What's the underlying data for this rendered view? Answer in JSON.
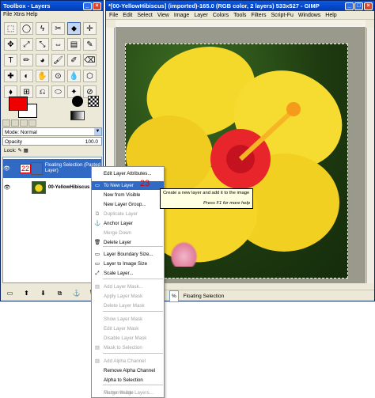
{
  "toolbox": {
    "title": "Toolbox - Layers",
    "menu": "File  Xtns  Help",
    "tools": [
      "⬚",
      "◯",
      "ϟ",
      "✂",
      "⬥",
      "✛",
      "✥",
      "⤢",
      "⤡",
      "⇔",
      "▤",
      "✎",
      "T",
      "✏",
      "◕",
      "🖌",
      "✐",
      "⌫",
      "✚",
      "◐",
      "✋",
      "⊙",
      "💧",
      "⬡",
      "⬧",
      "⊞",
      "⎌",
      "⬭",
      "✦",
      "⊘"
    ],
    "mode_label": "Mode: Normal",
    "opacity_label": "Opacity",
    "opacity_value": "100.0",
    "lock_label": "Lock:",
    "layers": [
      {
        "name": "Floating Selection (Pasted Layer)",
        "selected": true
      },
      {
        "name": "00-YellowHibiscus",
        "selected": false
      }
    ],
    "annotation_22": "22",
    "bottom_buttons": [
      "▭",
      "⬆",
      "⬇",
      "⧉",
      "⚓",
      "🗑"
    ]
  },
  "image_window": {
    "title": "*[00-YellowHibiscus] (imported)-165.0 (RGB color, 2 layers) 533x527 - GIMP",
    "menus": [
      "File",
      "Edit",
      "Select",
      "View",
      "Image",
      "Layer",
      "Colors",
      "Tools",
      "Filters",
      "Script-Fu",
      "Windows",
      "Help"
    ],
    "zoom": "%",
    "status": "Floating Selection"
  },
  "context_menu": {
    "items": [
      {
        "label": "Edit Layer Attributes...",
        "disabled": false,
        "highlight": false
      },
      {
        "label": "To New Layer",
        "disabled": false,
        "highlight": true
      },
      {
        "label": "New from Visible",
        "disabled": false,
        "highlight": false
      },
      {
        "label": "New Layer Group...",
        "disabled": false,
        "highlight": false
      },
      {
        "label": "Duplicate Layer",
        "disabled": true,
        "highlight": false
      },
      {
        "label": "Anchor Layer",
        "disabled": false,
        "highlight": false
      },
      {
        "label": "Merge Down",
        "disabled": true,
        "highlight": false
      },
      {
        "label": "Delete Layer",
        "disabled": false,
        "highlight": false
      },
      {
        "label": "Layer Boundary Size...",
        "disabled": false,
        "highlight": false
      },
      {
        "label": "Layer to Image Size",
        "disabled": false,
        "highlight": false
      },
      {
        "label": "Scale Layer...",
        "disabled": false,
        "highlight": false
      },
      {
        "label": "Add Layer Mask...",
        "disabled": true,
        "highlight": false
      },
      {
        "label": "Apply Layer Mask",
        "disabled": true,
        "highlight": false
      },
      {
        "label": "Delete Layer Mask",
        "disabled": true,
        "highlight": false
      },
      {
        "label": "Show Layer Mask",
        "disabled": true,
        "highlight": false
      },
      {
        "label": "Edit Layer Mask",
        "disabled": true,
        "highlight": false
      },
      {
        "label": "Disable Layer Mask",
        "disabled": true,
        "highlight": false
      },
      {
        "label": "Mask to Selection",
        "disabled": true,
        "highlight": false
      },
      {
        "label": "Add Alpha Channel",
        "disabled": true,
        "highlight": false
      },
      {
        "label": "Remove Alpha Channel",
        "disabled": false,
        "highlight": false
      },
      {
        "label": "Alpha to Selection",
        "disabled": false,
        "highlight": false
      },
      {
        "label": "Merge Visible Layers...",
        "disabled": true,
        "highlight": false
      },
      {
        "label": "Flatten Image",
        "disabled": true,
        "highlight": false
      }
    ],
    "annotation_23": "23"
  },
  "tooltip": {
    "text": "Create a new layer and add it to the image",
    "help": "Press F1 for more help"
  }
}
